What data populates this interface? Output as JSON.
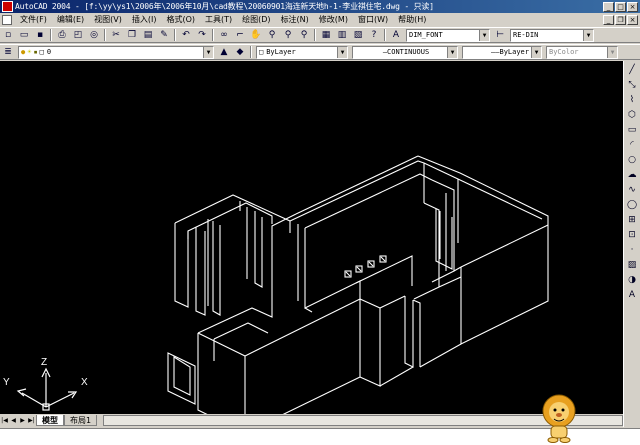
{
  "window": {
    "title": "AutoCAD 2004 - [f:\\yy\\ys1\\2006年\\2006年10月\\cad教程\\20060901海连新天地h-1-李业祺住宅.dwg - 只读]",
    "controls": {
      "minimize": "_",
      "maximize": "□",
      "close": "×"
    }
  },
  "menu": {
    "items": [
      "文件(F)",
      "编辑(E)",
      "视图(V)",
      "插入(I)",
      "格式(O)",
      "工具(T)",
      "绘图(D)",
      "标注(N)",
      "修改(M)",
      "窗口(W)",
      "帮助(H)"
    ],
    "doc_controls": {
      "minimize": "_",
      "restore": "❐",
      "close": "×"
    }
  },
  "toolbar1": {
    "text_style": "DIM_FONT",
    "dim_style": "RE-DIN"
  },
  "toolbar2": {
    "layer": "0",
    "color": "ByLayer",
    "linetype": "CONTINUOUS",
    "lineweight": "ByLayer",
    "plotstyle": "ByColor"
  },
  "ucs": {
    "x_label": "X",
    "y_label": "Y",
    "z_label": "Z"
  },
  "tabs": {
    "model": "模型",
    "layout1": "布局1"
  },
  "icons": {
    "draw_tools": [
      "line-icon",
      "xline-icon",
      "polyline-icon",
      "polygon-icon",
      "rectangle-icon",
      "arc-icon",
      "circle-icon",
      "revcloud-icon",
      "spline-icon",
      "ellipse-icon",
      "insert-block-icon",
      "make-block-icon",
      "point-icon",
      "hatch-icon",
      "region-icon",
      "mtext-icon"
    ]
  },
  "colors": {
    "canvas": "#000000",
    "lines": "#ffffff",
    "titlebar": "#0a246a"
  }
}
